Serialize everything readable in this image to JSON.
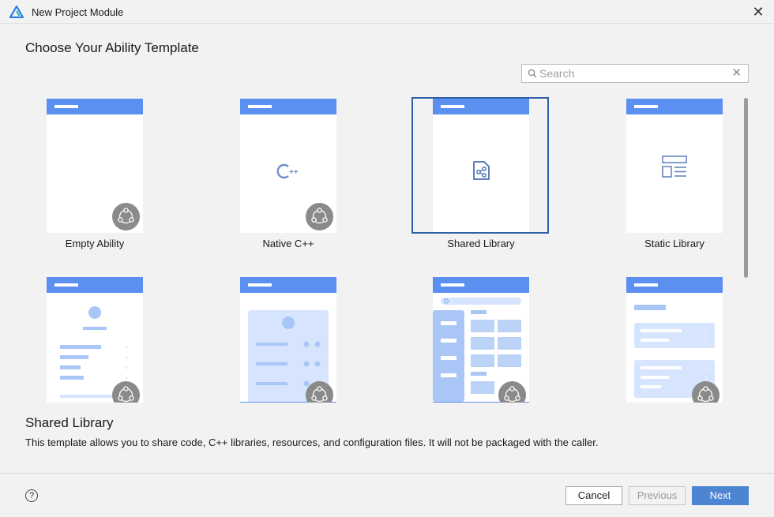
{
  "window": {
    "title": "New Project Module",
    "close_glyph": "✕"
  },
  "heading": "Choose Your Ability Template",
  "search": {
    "placeholder": "Search",
    "value": "",
    "clear_glyph": "✕"
  },
  "templates": [
    {
      "label": "Empty Ability",
      "icon": "empty-ability-preview"
    },
    {
      "label": "Native C++",
      "icon": "cpp-icon",
      "icon_text": "C++"
    },
    {
      "label": "Shared Library",
      "icon": "shared-library-icon",
      "selected": true
    },
    {
      "label": "Static Library",
      "icon": "static-library-icon"
    },
    {
      "label": "",
      "icon": "profile-list-preview"
    },
    {
      "label": "",
      "icon": "card-list-preview"
    },
    {
      "label": "",
      "icon": "sidebar-grid-preview"
    },
    {
      "label": "",
      "icon": "card-list-2-preview"
    }
  ],
  "detail": {
    "title": "Shared Library",
    "description": "This template allows you to share code, C++ libraries, resources, and configuration files. It will not be packaged with the caller."
  },
  "footer": {
    "help_glyph": "?",
    "cancel_label": "Cancel",
    "previous_label": "Previous",
    "next_label": "Next"
  },
  "colors": {
    "accent": "#5b8ff0",
    "primary_button": "#4e85d2",
    "selected_border": "#2f5fa8",
    "preview_fill": "#d6e5fd",
    "badge": "#8a8a8a"
  }
}
